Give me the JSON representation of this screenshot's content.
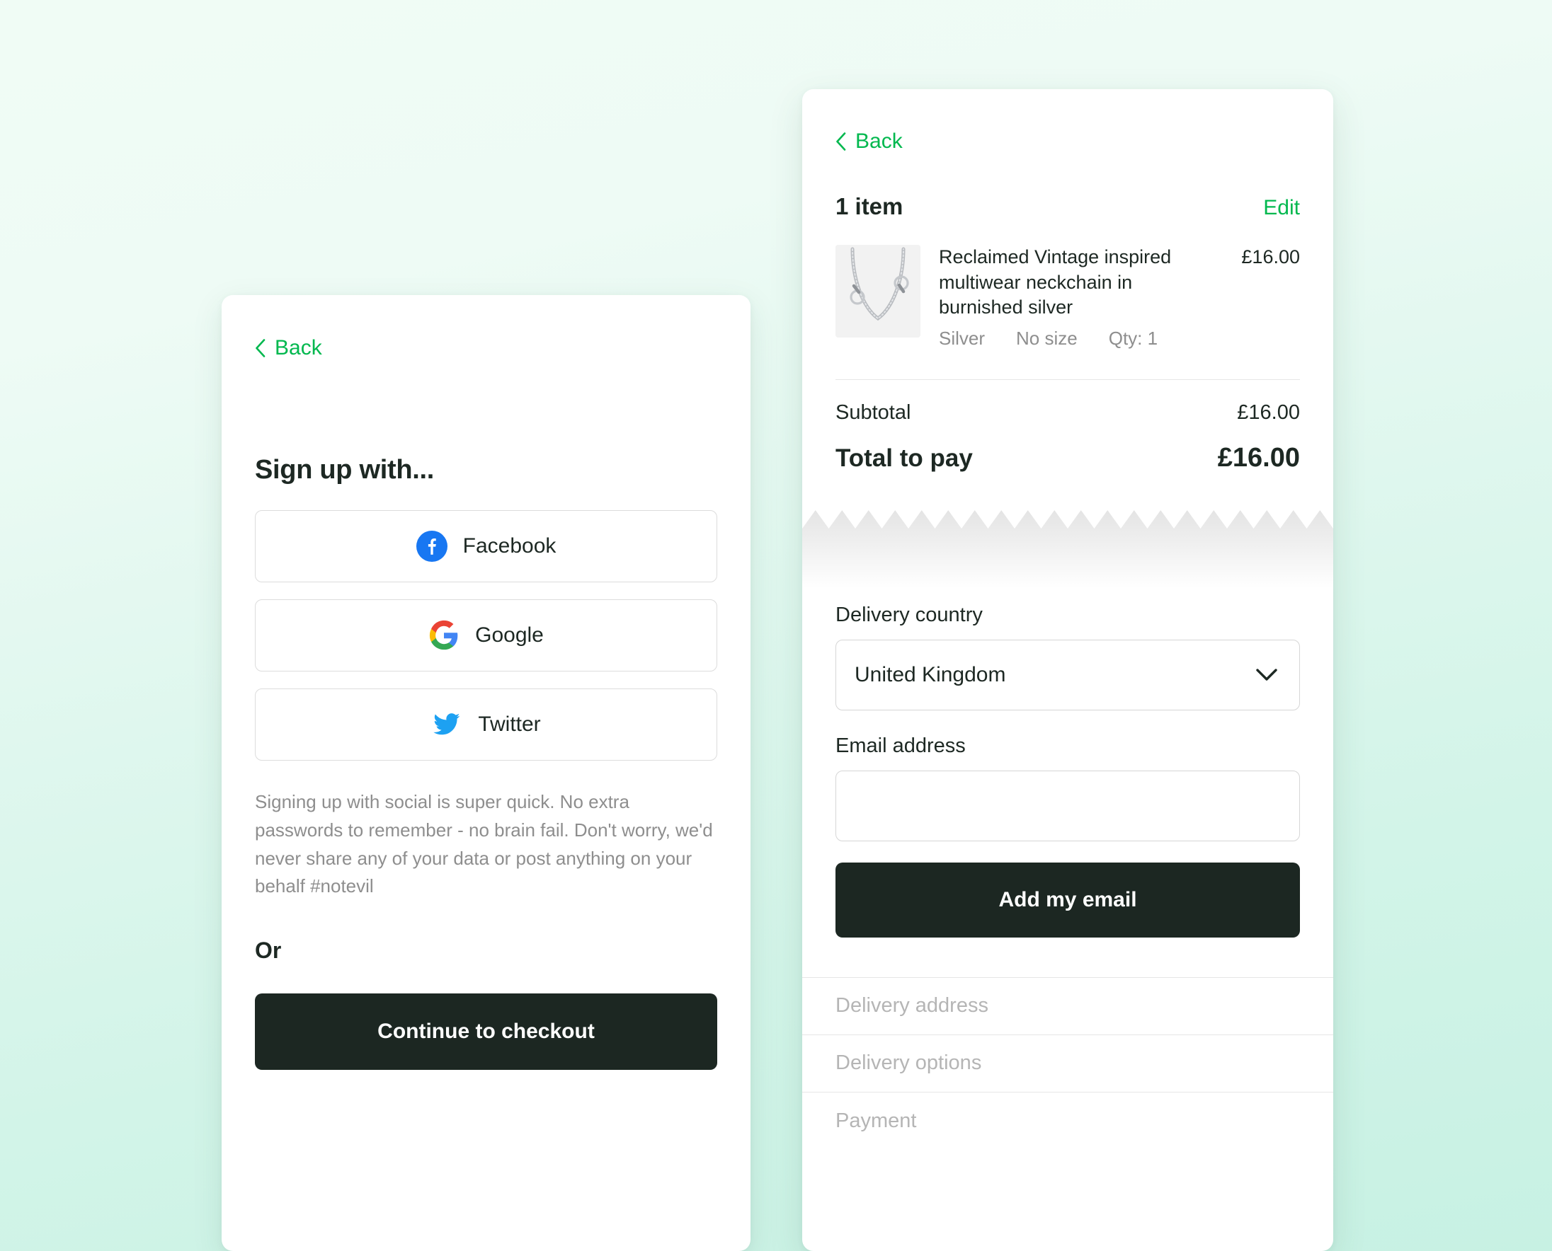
{
  "theme": {
    "accent_green": "#00b84e",
    "dark_button": "#1c2722",
    "muted_text": "#8e8e8e",
    "placeholder_text": "#b5b5b5",
    "background_top": "#f0fcf5",
    "background_bottom": "#c7f1e3"
  },
  "signup_panel": {
    "back_label": "Back",
    "title": "Sign up with...",
    "social_buttons": [
      {
        "label": "Facebook",
        "icon": "facebook-icon",
        "color": "#1877F2"
      },
      {
        "label": "Google",
        "icon": "google-icon",
        "color": "#4285F4"
      },
      {
        "label": "Twitter",
        "icon": "twitter-icon",
        "color": "#1DA1F2"
      }
    ],
    "note": "Signing up with social is super quick. No extra passwords to remember - no brain fail. Don't worry, we'd never share any of your data or post anything on your behalf #notevil",
    "or_label": "Or",
    "continue_label": "Continue to checkout"
  },
  "checkout_panel": {
    "back_label": "Back",
    "bag": {
      "count_label": "1 item",
      "edit_label": "Edit",
      "items": [
        {
          "name": "Reclaimed Vintage inspired multiwear neckchain in burnished silver",
          "price": "£16.00",
          "colour": "Silver",
          "size": "No size",
          "qty": "Qty: 1",
          "thumb_alt": "silver-neckchain-thumbnail"
        }
      ]
    },
    "totals": {
      "subtotal_label": "Subtotal",
      "subtotal_value": "£16.00",
      "total_label": "Total to pay",
      "total_value": "£16.00"
    },
    "form": {
      "country_label": "Delivery country",
      "country_value": "United Kingdom",
      "email_label": "Email address",
      "email_value": "",
      "email_placeholder": "",
      "submit_label": "Add my email"
    },
    "steps": [
      {
        "label": "Delivery address"
      },
      {
        "label": "Delivery options"
      },
      {
        "label": "Payment"
      }
    ]
  }
}
